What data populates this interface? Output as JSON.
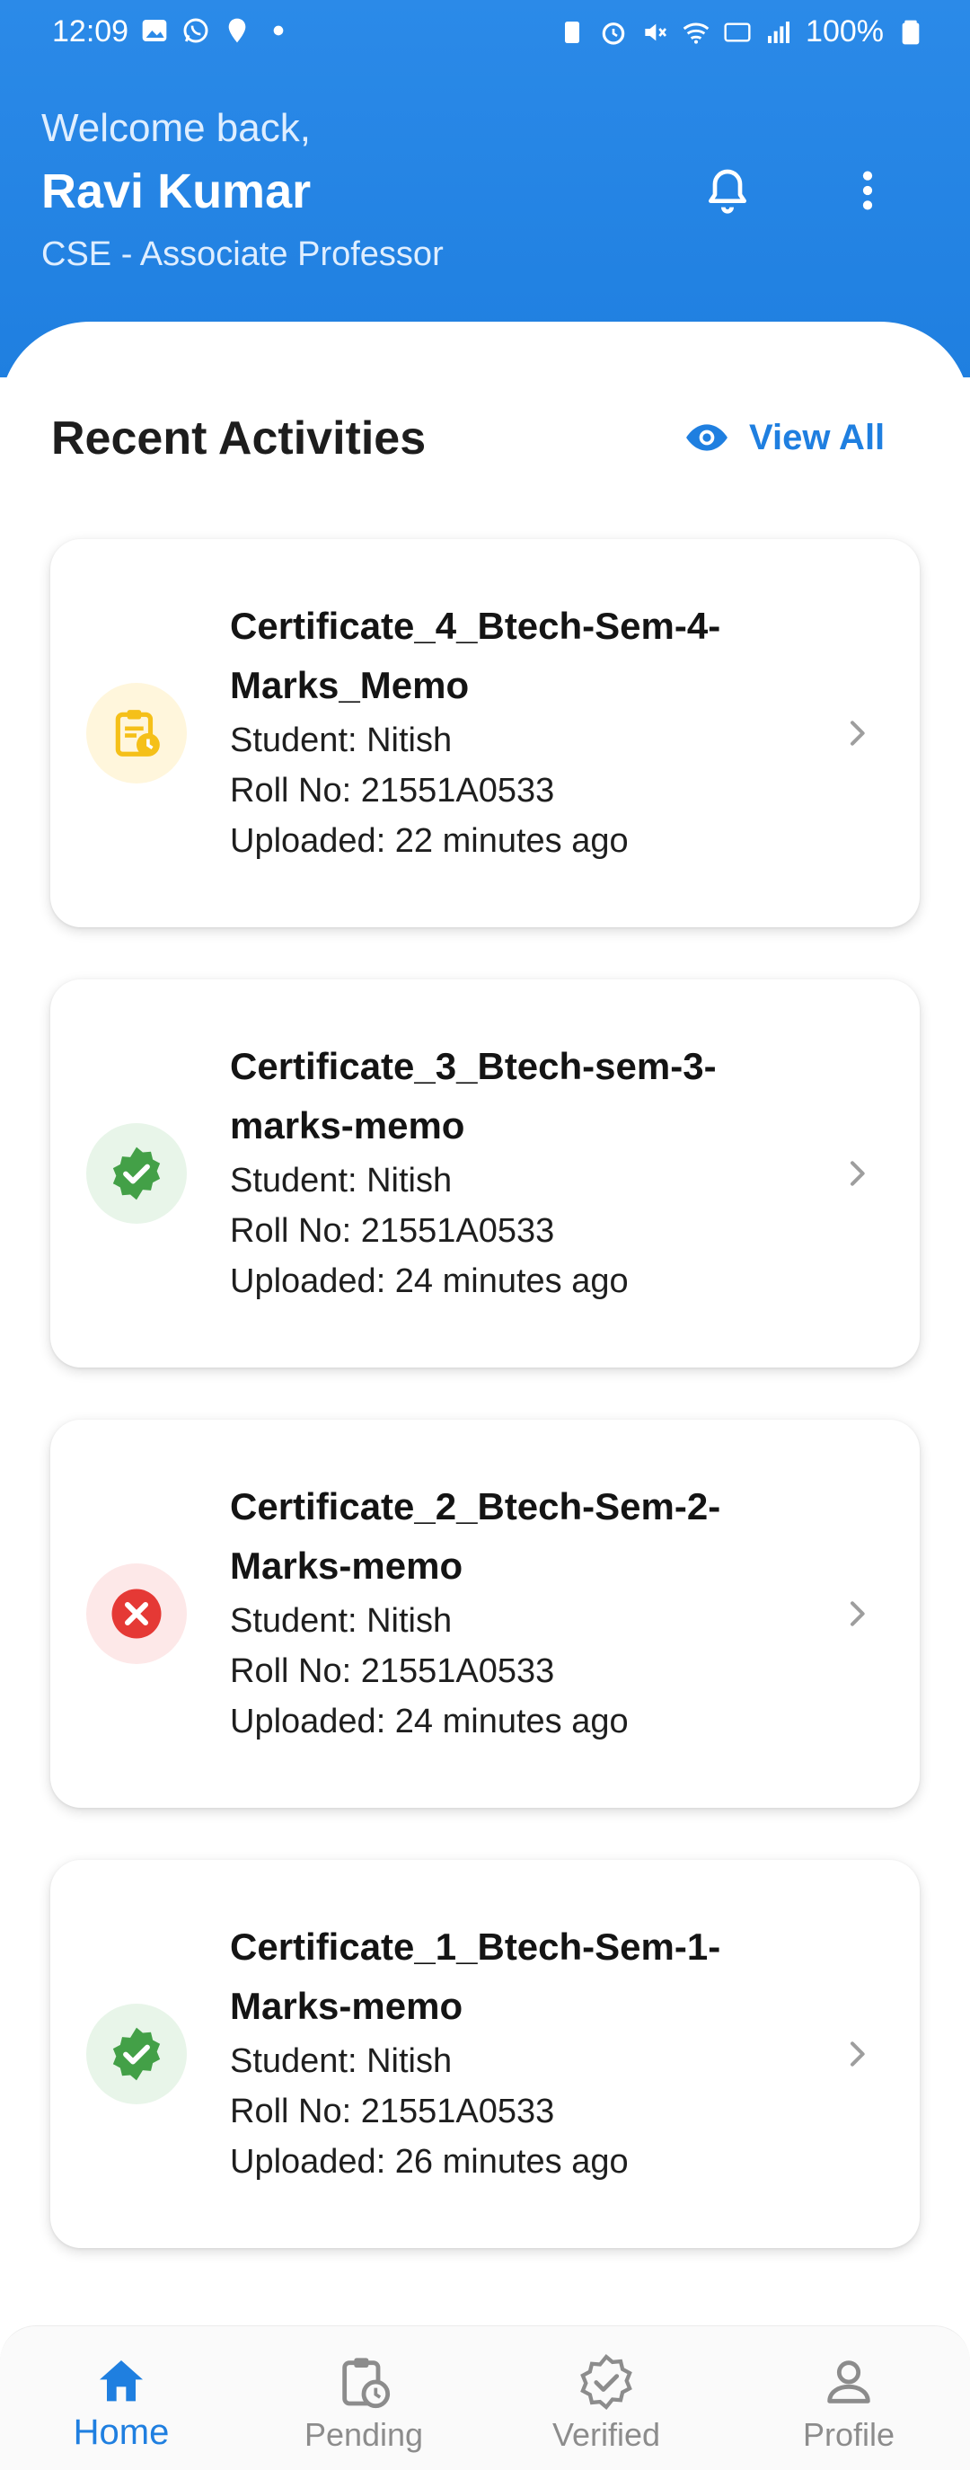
{
  "status_bar": {
    "time": "12:09",
    "battery": "100%"
  },
  "header": {
    "welcome": "Welcome back,",
    "name": "Ravi Kumar",
    "role": "CSE - Associate Professor"
  },
  "section": {
    "title": "Recent Activities",
    "view_all_label": "View All"
  },
  "activities": [
    {
      "title_line1": "Certificate_4_Btech-Sem-4-",
      "title_line2": "Marks_Memo",
      "student": "Student: Nitish",
      "roll": "Roll No: 21551A0533",
      "uploaded": "Uploaded: 22 minutes ago",
      "status": "pending",
      "icon": "clipboard-clock-icon",
      "icon_color": "#f5c019",
      "icon_bg": "#fff6dc"
    },
    {
      "title_line1": "Certificate_3_Btech-sem-3-",
      "title_line2": "marks-memo",
      "student": "Student: Nitish",
      "roll": "Roll No: 21551A0533",
      "uploaded": "Uploaded: 24 minutes ago",
      "status": "verified",
      "icon": "verified-badge-icon",
      "icon_color": "#43a047",
      "icon_bg": "#e8f5e9"
    },
    {
      "title_line1": "Certificate_2_Btech-Sem-2-",
      "title_line2": "Marks-memo",
      "student": "Student: Nitish",
      "roll": "Roll No: 21551A0533",
      "uploaded": "Uploaded: 24 minutes ago",
      "status": "rejected",
      "icon": "cancel-circle-icon",
      "icon_color": "#e53935",
      "icon_bg": "#fde8e8"
    },
    {
      "title_line1": "Certificate_1_Btech-Sem-1-",
      "title_line2": "Marks-memo",
      "student": "Student: Nitish",
      "roll": "Roll No: 21551A0533",
      "uploaded": "Uploaded: 26 minutes ago",
      "status": "verified",
      "icon": "verified-badge-icon",
      "icon_color": "#43a047",
      "icon_bg": "#e8f5e9"
    }
  ],
  "bottom_nav": [
    {
      "label": "Home",
      "icon": "home-icon",
      "active": true
    },
    {
      "label": "Pending",
      "icon": "clipboard-clock-icon",
      "active": false
    },
    {
      "label": "Verified",
      "icon": "verified-badge-icon",
      "active": false
    },
    {
      "label": "Profile",
      "icon": "person-icon",
      "active": false
    }
  ],
  "colors": {
    "primary": "#1f7fe0",
    "inactive": "#8c8c8c"
  }
}
